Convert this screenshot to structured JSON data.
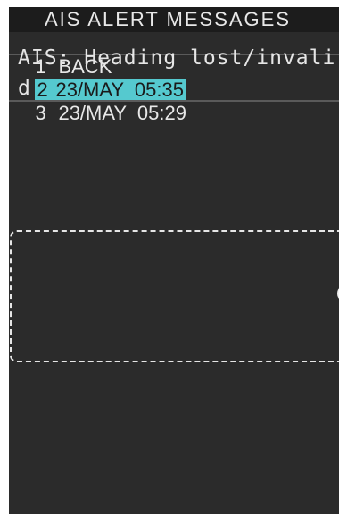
{
  "header": {
    "title": "AIS ALERT MESSAGES"
  },
  "menu": {
    "items": [
      {
        "number": "1",
        "label": "BACK",
        "selected": false
      },
      {
        "number": "2",
        "label": "23/MAY  05:35",
        "selected": true
      },
      {
        "number": "3",
        "label": "23/MAY  05:29",
        "selected": false
      }
    ]
  },
  "message": {
    "text": "AIS: Heading lost/invalid"
  },
  "colors": {
    "panel_background": "#2b2b2b",
    "title_background": "#1c1c1c",
    "selection_highlight": "#55c9cf",
    "text": "#e8e8e8"
  }
}
